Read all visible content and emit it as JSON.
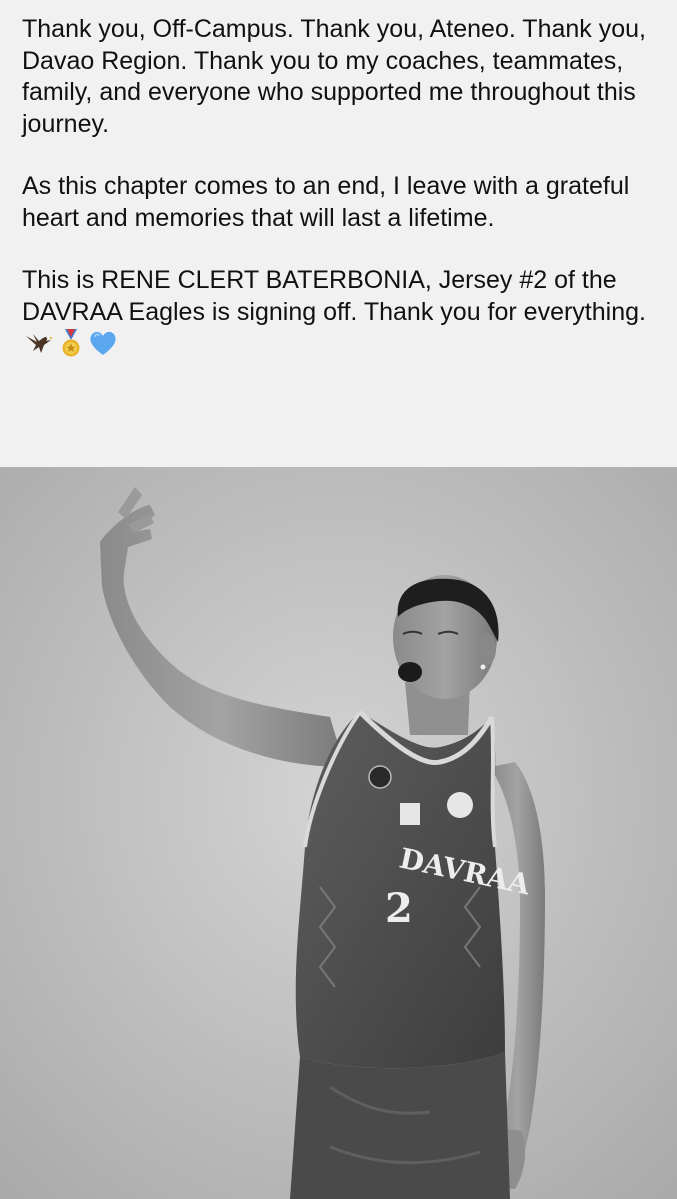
{
  "post": {
    "paragraphs": [
      "Thank you, Off-Campus. Thank you, Ateneo. Thank you, Davao Region. Thank you to my coaches, teammates, family, and everyone who supported me throughout this journey.",
      "As this chapter comes to an end, I leave with a grateful heart and memories that will last a lifetime.",
      "This is RENE CLERT BATERBONIA, Jersey #2 of the DAVRAA Eagles is signing off. Thank you for everything."
    ],
    "emojis": [
      "eagle-icon",
      "medal-icon",
      "blue-heart-icon"
    ]
  },
  "photo": {
    "jersey_text": "DAVRAA",
    "jersey_number": "2",
    "style": "black-and-white"
  },
  "colors": {
    "background": "#f1f1f1",
    "text": "#111111",
    "heart": "#5aa7f0",
    "medal": "#e8b22a"
  }
}
